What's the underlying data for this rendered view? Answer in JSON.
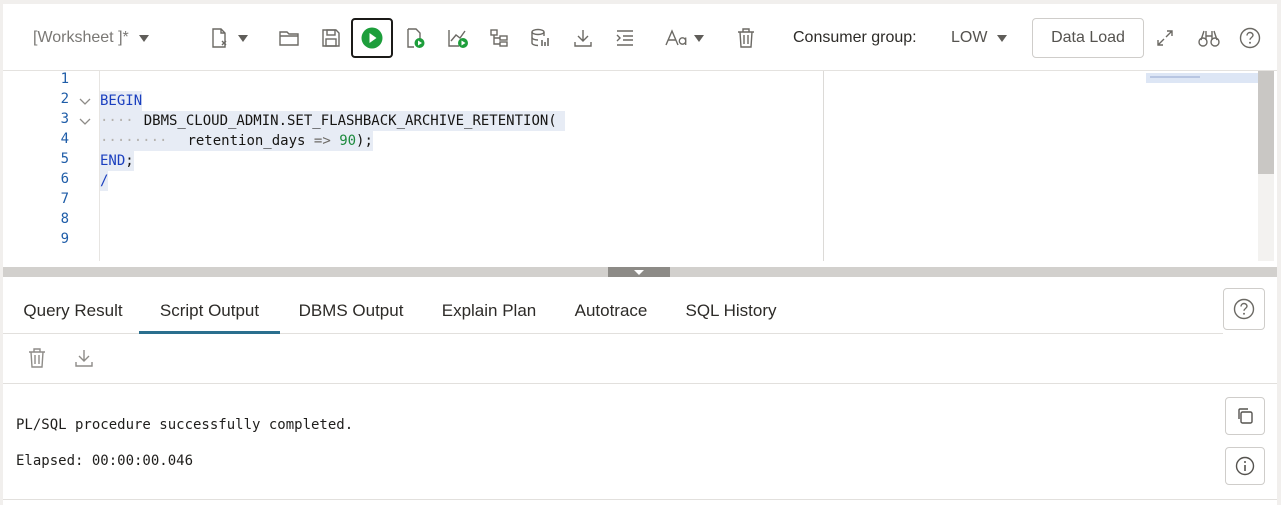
{
  "toolbar": {
    "worksheet_label": "[Worksheet ]*",
    "consumer_group_label": "Consumer group:",
    "consumer_group_value": "LOW",
    "data_load_label": "Data Load",
    "run_color": "#1d9e3b"
  },
  "editor": {
    "line_numbers": [
      "1",
      "2",
      "3",
      "4",
      "5",
      "6",
      "7",
      "8",
      "9"
    ],
    "line2_kw": "BEGIN",
    "line3_text": "DBMS_CLOUD_ADMIN.SET_FLASHBACK_ARCHIVE_RETENTION(",
    "line4_param": "retention_days",
    "line4_op": "=>",
    "line4_num": "90",
    "line4_tail": ");",
    "line5_kw": "END",
    "line5_tail": ";",
    "line6_text": "/"
  },
  "panel": {
    "tabs": [
      {
        "label": "Query Result"
      },
      {
        "label": "Script Output"
      },
      {
        "label": "DBMS Output"
      },
      {
        "label": "Explain Plan"
      },
      {
        "label": "Autotrace"
      },
      {
        "label": "SQL History"
      }
    ],
    "active_tab": "Script Output",
    "output_lines": [
      "PL/SQL procedure successfully completed.",
      "Elapsed: 00:00:00.046"
    ]
  }
}
